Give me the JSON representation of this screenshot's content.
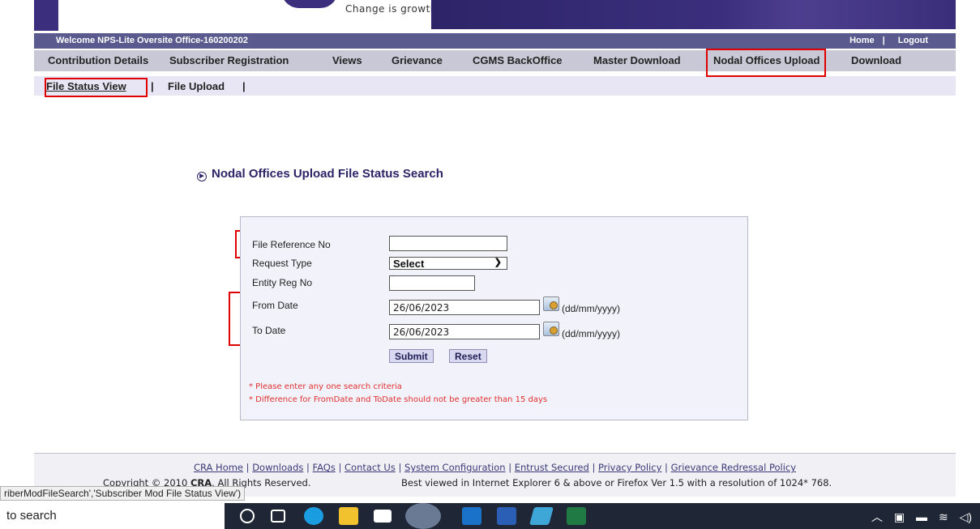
{
  "banner": {
    "tagline": "Change is growth"
  },
  "welcome": {
    "text": "Welcome NPS-Lite Oversite Office-160200202",
    "home": "Home",
    "separator": "|",
    "logout": "Logout"
  },
  "menu": {
    "items": [
      "Contribution Details",
      "Subscriber Registration",
      "Views",
      "Grievance",
      "CGMS BackOffice",
      "Master Download",
      "Nodal Offices Upload",
      "Download"
    ]
  },
  "submenu": {
    "items": [
      "File Status View",
      "File Upload"
    ],
    "separator": "|"
  },
  "page": {
    "title": "Nodal Offices Upload File Status Search"
  },
  "form": {
    "file_ref_label": "File Reference No",
    "file_ref_value": "",
    "request_type_label": "Request Type",
    "request_type_value": "Select",
    "entity_label": "Entity Reg No",
    "entity_value": "",
    "from_date_label": "From Date",
    "from_date_value": "26/06/2023",
    "to_date_label": "To Date",
    "to_date_value": "26/06/2023",
    "date_format": "(dd/mm/yyyy)",
    "submit": "Submit",
    "reset": "Reset",
    "note1": "* Please enter any one search criteria",
    "note2": "* Difference for FromDate and ToDate should not be greater than 15 days"
  },
  "footer": {
    "links": [
      "CRA Home",
      "Downloads",
      "FAQs",
      "Contact Us",
      "System Configuration",
      "Entrust Secured",
      "Privacy Policy",
      "Grievance Redressal Policy"
    ],
    "copyright_prefix": "Copyright © 2010 ",
    "copyright_org": "CRA",
    "copyright_suffix": ". All Rights Reserved.",
    "best_viewed": "Best viewed in Internet Explorer 6 & above or Firefox Ver 1.5 with a resolution of 1024* 768."
  },
  "status_tooltip": "riberModFileSearch','Subscriber Mod File Status View')",
  "taskbar": {
    "search_placeholder": "to search",
    "apps": [
      "search-circle-icon",
      "task-view-icon",
      "edge-icon",
      "file-explorer-icon",
      "mail-icon",
      "chrome-icon",
      "outlook-icon",
      "word-icon",
      "app-icon",
      "excel-icon"
    ],
    "tray": [
      "chevron-up-icon",
      "notification-icon",
      "battery-icon",
      "wifi-icon",
      "volume-icon"
    ]
  }
}
